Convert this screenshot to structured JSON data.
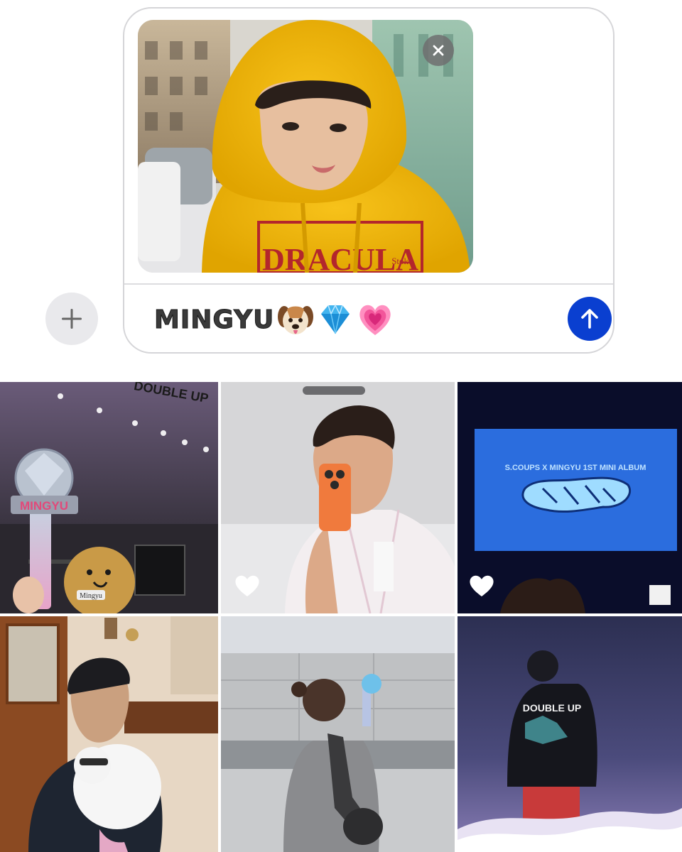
{
  "composer": {
    "message_text": "MINGYU",
    "emoji": [
      "dog-face-emoji",
      "gem-emoji",
      "growing-heart-emoji"
    ],
    "attachment": {
      "type": "photo",
      "shirt_text": "DRACULA",
      "shirt_subtext": "Stoke"
    },
    "icons": {
      "add": "plus-icon",
      "remove": "close-icon",
      "send": "arrow-up-icon"
    },
    "colors": {
      "send": "#0a3fd0",
      "border": "#d5d5d8"
    }
  },
  "photo_grid": {
    "cells": [
      {
        "id": "lightstick-stage",
        "lightstick_label": "MINGYU",
        "keychain_text": "Mingyu",
        "backdrop_text": "DOUBLE UP",
        "liked": false
      },
      {
        "id": "mirror-selfie",
        "liked": true
      },
      {
        "id": "screen-album",
        "screen_title": "S.COUPS X MINGYU 1ST MINI ALBUM",
        "liked": true
      },
      {
        "id": "dog-portrait",
        "liked": false
      },
      {
        "id": "fan-lightstick",
        "liked": false
      },
      {
        "id": "stage-back",
        "jacket_text": "DOUBLE UP",
        "liked": false
      }
    ]
  }
}
